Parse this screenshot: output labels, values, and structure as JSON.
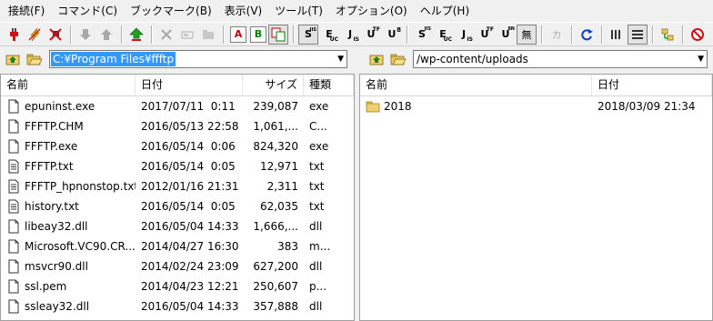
{
  "menu": [
    "接続(F)",
    "コマンド(C)",
    "ブックマーク(B)",
    "表示(V)",
    "ツール(T)",
    "オプション(O)",
    "ヘルプ(H)"
  ],
  "toolbar": {
    "text_buttons": {
      "ascii": "A",
      "binary": "B",
      "s": "S",
      "e": "E",
      "j": "J",
      "u": "U",
      "u8": "U",
      "u8b": "U",
      "mu": "無",
      "ka": "カ"
    },
    "subs": {
      "sjis": "JIS",
      "euc": "UC",
      "jis": "IS",
      "utf": "TF",
      "u8": "8",
      "u8n": "8N"
    }
  },
  "local": {
    "path": "C:¥Program Files¥ffftp",
    "columns": {
      "name": "名前",
      "date": "日付",
      "size": "サイズ",
      "type": "種類"
    },
    "files": [
      {
        "icon": "file",
        "name": "epuninst.exe",
        "date": "2017/07/11  0:11",
        "size": "239,087",
        "type": "exe"
      },
      {
        "icon": "file",
        "name": "FFFTP.CHM",
        "date": "2016/05/13 22:58",
        "size": "1,061,...",
        "type": "C..."
      },
      {
        "icon": "file",
        "name": "FFFTP.exe",
        "date": "2016/05/14  0:06",
        "size": "824,320",
        "type": "exe"
      },
      {
        "icon": "text",
        "name": "FFFTP.txt",
        "date": "2016/05/14  0:05",
        "size": "12,971",
        "type": "txt"
      },
      {
        "icon": "text",
        "name": "FFFTP_hpnonstop.txt",
        "date": "2012/01/16 21:31",
        "size": "2,311",
        "type": "txt"
      },
      {
        "icon": "text",
        "name": "history.txt",
        "date": "2016/05/14  0:05",
        "size": "62,035",
        "type": "txt"
      },
      {
        "icon": "file",
        "name": "libeay32.dll",
        "date": "2016/05/04 14:33",
        "size": "1,666,...",
        "type": "dll"
      },
      {
        "icon": "file",
        "name": "Microsoft.VC90.CR...",
        "date": "2014/04/27 16:30",
        "size": "383",
        "type": "m..."
      },
      {
        "icon": "file",
        "name": "msvcr90.dll",
        "date": "2014/02/24 23:09",
        "size": "627,200",
        "type": "dll"
      },
      {
        "icon": "file",
        "name": "ssl.pem",
        "date": "2014/04/23 12:21",
        "size": "250,607",
        "type": "p..."
      },
      {
        "icon": "file",
        "name": "ssleay32.dll",
        "date": "2016/05/04 14:33",
        "size": "357,888",
        "type": "dll"
      }
    ]
  },
  "remote": {
    "path": "/wp-content/uploads",
    "columns": {
      "name": "名前",
      "date": "日付"
    },
    "files": [
      {
        "icon": "folder",
        "name": "2018",
        "date": "2018/03/09 21:34"
      }
    ]
  }
}
